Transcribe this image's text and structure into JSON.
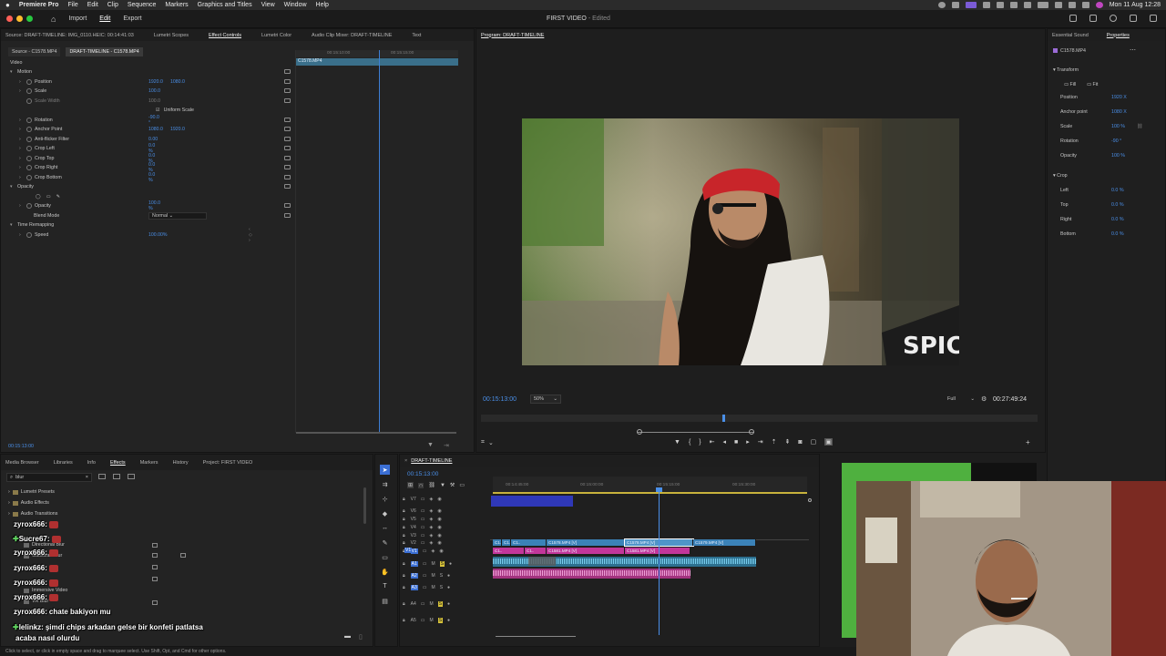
{
  "menubar": {
    "app": "Premiere Pro",
    "items": [
      "File",
      "Edit",
      "Clip",
      "Sequence",
      "Markers",
      "Graphics and Titles",
      "View",
      "Window",
      "Help"
    ],
    "clock": "Mon 11 Aug  12:28"
  },
  "header": {
    "tabs": [
      "Import",
      "Edit",
      "Export"
    ],
    "active_tab": "Edit",
    "title": "FIRST VIDEO",
    "title_suffix": " - Edited"
  },
  "source_panel": {
    "tabs": [
      "Source: DRAFT-TIMELINE: IMG_0110.HEIC: 00:14:41:03",
      "Lumetri Scopes",
      "Effect Controls",
      "Lumetri Color",
      "Audio Clip Mixer: DRAFT-TIMELINE",
      "Text"
    ],
    "active_tab": "Effect Controls",
    "subtabs": [
      "Source - C1578.MP4",
      "DRAFT-TIMELINE - C1578.MP4"
    ],
    "section_video": "Video",
    "ruler_times": [
      "00:15:10:00",
      "00:15:15:00"
    ],
    "clip_label": "C1578.MP4",
    "timecode": "00:15:13:00",
    "properties": [
      {
        "label": "Motion",
        "value": "",
        "value2": "",
        "kind": "group"
      },
      {
        "label": "Position",
        "value": "1920.0",
        "value2": "1080.0",
        "kind": "prop"
      },
      {
        "label": "Scale",
        "value": "100.0",
        "value2": "",
        "kind": "prop"
      },
      {
        "label": "Scale Width",
        "value": "100.0",
        "value2": "",
        "kind": "disabled"
      },
      {
        "label": "Uniform Scale",
        "value": "",
        "value2": "",
        "kind": "check"
      },
      {
        "label": "Rotation",
        "value": "-90.0 °",
        "value2": "",
        "kind": "prop"
      },
      {
        "label": "Anchor Point",
        "value": "1080.0",
        "value2": "1920.0",
        "kind": "prop"
      },
      {
        "label": "Anti-flicker Filter",
        "value": "0.00",
        "value2": "",
        "kind": "prop"
      },
      {
        "label": "Crop Left",
        "value": "0.0 %",
        "value2": "",
        "kind": "prop"
      },
      {
        "label": "Crop Top",
        "value": "0.0 %",
        "value2": "",
        "kind": "prop"
      },
      {
        "label": "Crop Right",
        "value": "0.0 %",
        "value2": "",
        "kind": "prop"
      },
      {
        "label": "Crop Bottom",
        "value": "0.0 %",
        "value2": "",
        "kind": "prop"
      },
      {
        "label": "Opacity",
        "value": "",
        "value2": "",
        "kind": "group"
      },
      {
        "label": "",
        "value": "",
        "value2": "",
        "kind": "masks"
      },
      {
        "label": "Opacity",
        "value": "100.0 %",
        "value2": "",
        "kind": "prop"
      },
      {
        "label": "Blend Mode",
        "value": "Normal",
        "value2": "",
        "kind": "select"
      },
      {
        "label": "Time Remapping",
        "value": "",
        "value2": "",
        "kind": "group"
      },
      {
        "label": "Speed",
        "value": "100.00%",
        "value2": "",
        "kind": "prop"
      }
    ]
  },
  "program_monitor": {
    "title": "Program: DRAFT-TIMELINE",
    "timecode": "00:15:13:00",
    "zoom": "50%",
    "quality": "Full",
    "duration": "00:27:49:24",
    "sign_text": "SPICI",
    "playhead_fraction": 0.6
  },
  "right_panel": {
    "tabs": [
      "Essential Sound",
      "Properties"
    ],
    "active_tab": "Properties",
    "clip_name": "C1578.MP4",
    "transform_title": "Transform",
    "fill_label": "Fill",
    "fit_label": "Fit",
    "rows": [
      {
        "label": "Position",
        "value": "1920 X"
      },
      {
        "label": "Anchor point",
        "value": "1080 X"
      },
      {
        "label": "Scale",
        "value": "100 %"
      },
      {
        "label": "Rotation",
        "value": "-90 °"
      },
      {
        "label": "Opacity",
        "value": "100 %"
      }
    ],
    "crop_title": "Crop",
    "crop_rows": [
      {
        "label": "Left",
        "value": "0.0 %"
      },
      {
        "label": "Top",
        "value": "0.0 %"
      },
      {
        "label": "Right",
        "value": "0.0 %"
      },
      {
        "label": "Bottom",
        "value": "0.0 %"
      }
    ]
  },
  "effects_panel": {
    "tabs": [
      "Media Browser",
      "Libraries",
      "Info",
      "Effects",
      "Markers",
      "History",
      "Project: FIRST VIDEO"
    ],
    "active_tab": "Effects",
    "search": "blur",
    "tree": [
      "Lumetri Presets",
      "Audio Effects",
      "Audio Transitions",
      "Directional Blur",
      "Gaussian Blur",
      "Immersive Video",
      "VR Blur"
    ]
  },
  "timeline": {
    "name": "DRAFT-TIMELINE",
    "timecode": "00:15:13:00",
    "ruler": [
      "00:14:45:00",
      "00:15:00:00",
      "00:15:15:00",
      "00:15:30:00"
    ],
    "video_tracks": [
      "V7",
      "V6",
      "V5",
      "V4",
      "V3",
      "V2",
      "V1"
    ],
    "audio_tracks": [
      "A1",
      "A2",
      "A3",
      "A4",
      "A5"
    ],
    "clips_v2": [
      "C1..",
      "C1..",
      "C1..",
      "C1578.MP4 [V]",
      "C1578.MP4 [V]",
      "C1579.MP4 [V]"
    ],
    "clips_v1": [
      "C1..",
      "C1..",
      "C1581.MP4 [V]",
      "C1581.MP4 [V]"
    ]
  },
  "chat": [
    {
      "user": "zyrox666:",
      "msg": ""
    },
    {
      "user": "Sucre67:",
      "msg": ""
    },
    {
      "user": "zyrox666:",
      "msg": ""
    },
    {
      "user": "zyrox666:",
      "msg": ""
    },
    {
      "user": "zyrox666:",
      "msg": ""
    },
    {
      "user": "zyrox666:",
      "msg": ""
    },
    {
      "user": "zyrox666:",
      "msg": "chate bakiyon mu"
    },
    {
      "user": "lelinkz:",
      "msg": "şimdi chips arkadan gelse bir konfeti patlatsa"
    },
    {
      "user": "",
      "msg": "acaba nasıl olurdu"
    }
  ],
  "status_bar": "Click to select, or click in empty space and drag to marquee select. Use Shift, Opt, and Cmd for other options.",
  "colors": {
    "accent": "#4a8fe8",
    "clip_blue": "#3b82b8",
    "clip_pink": "#c2369a",
    "audio_wave": "#7ad0f0"
  }
}
